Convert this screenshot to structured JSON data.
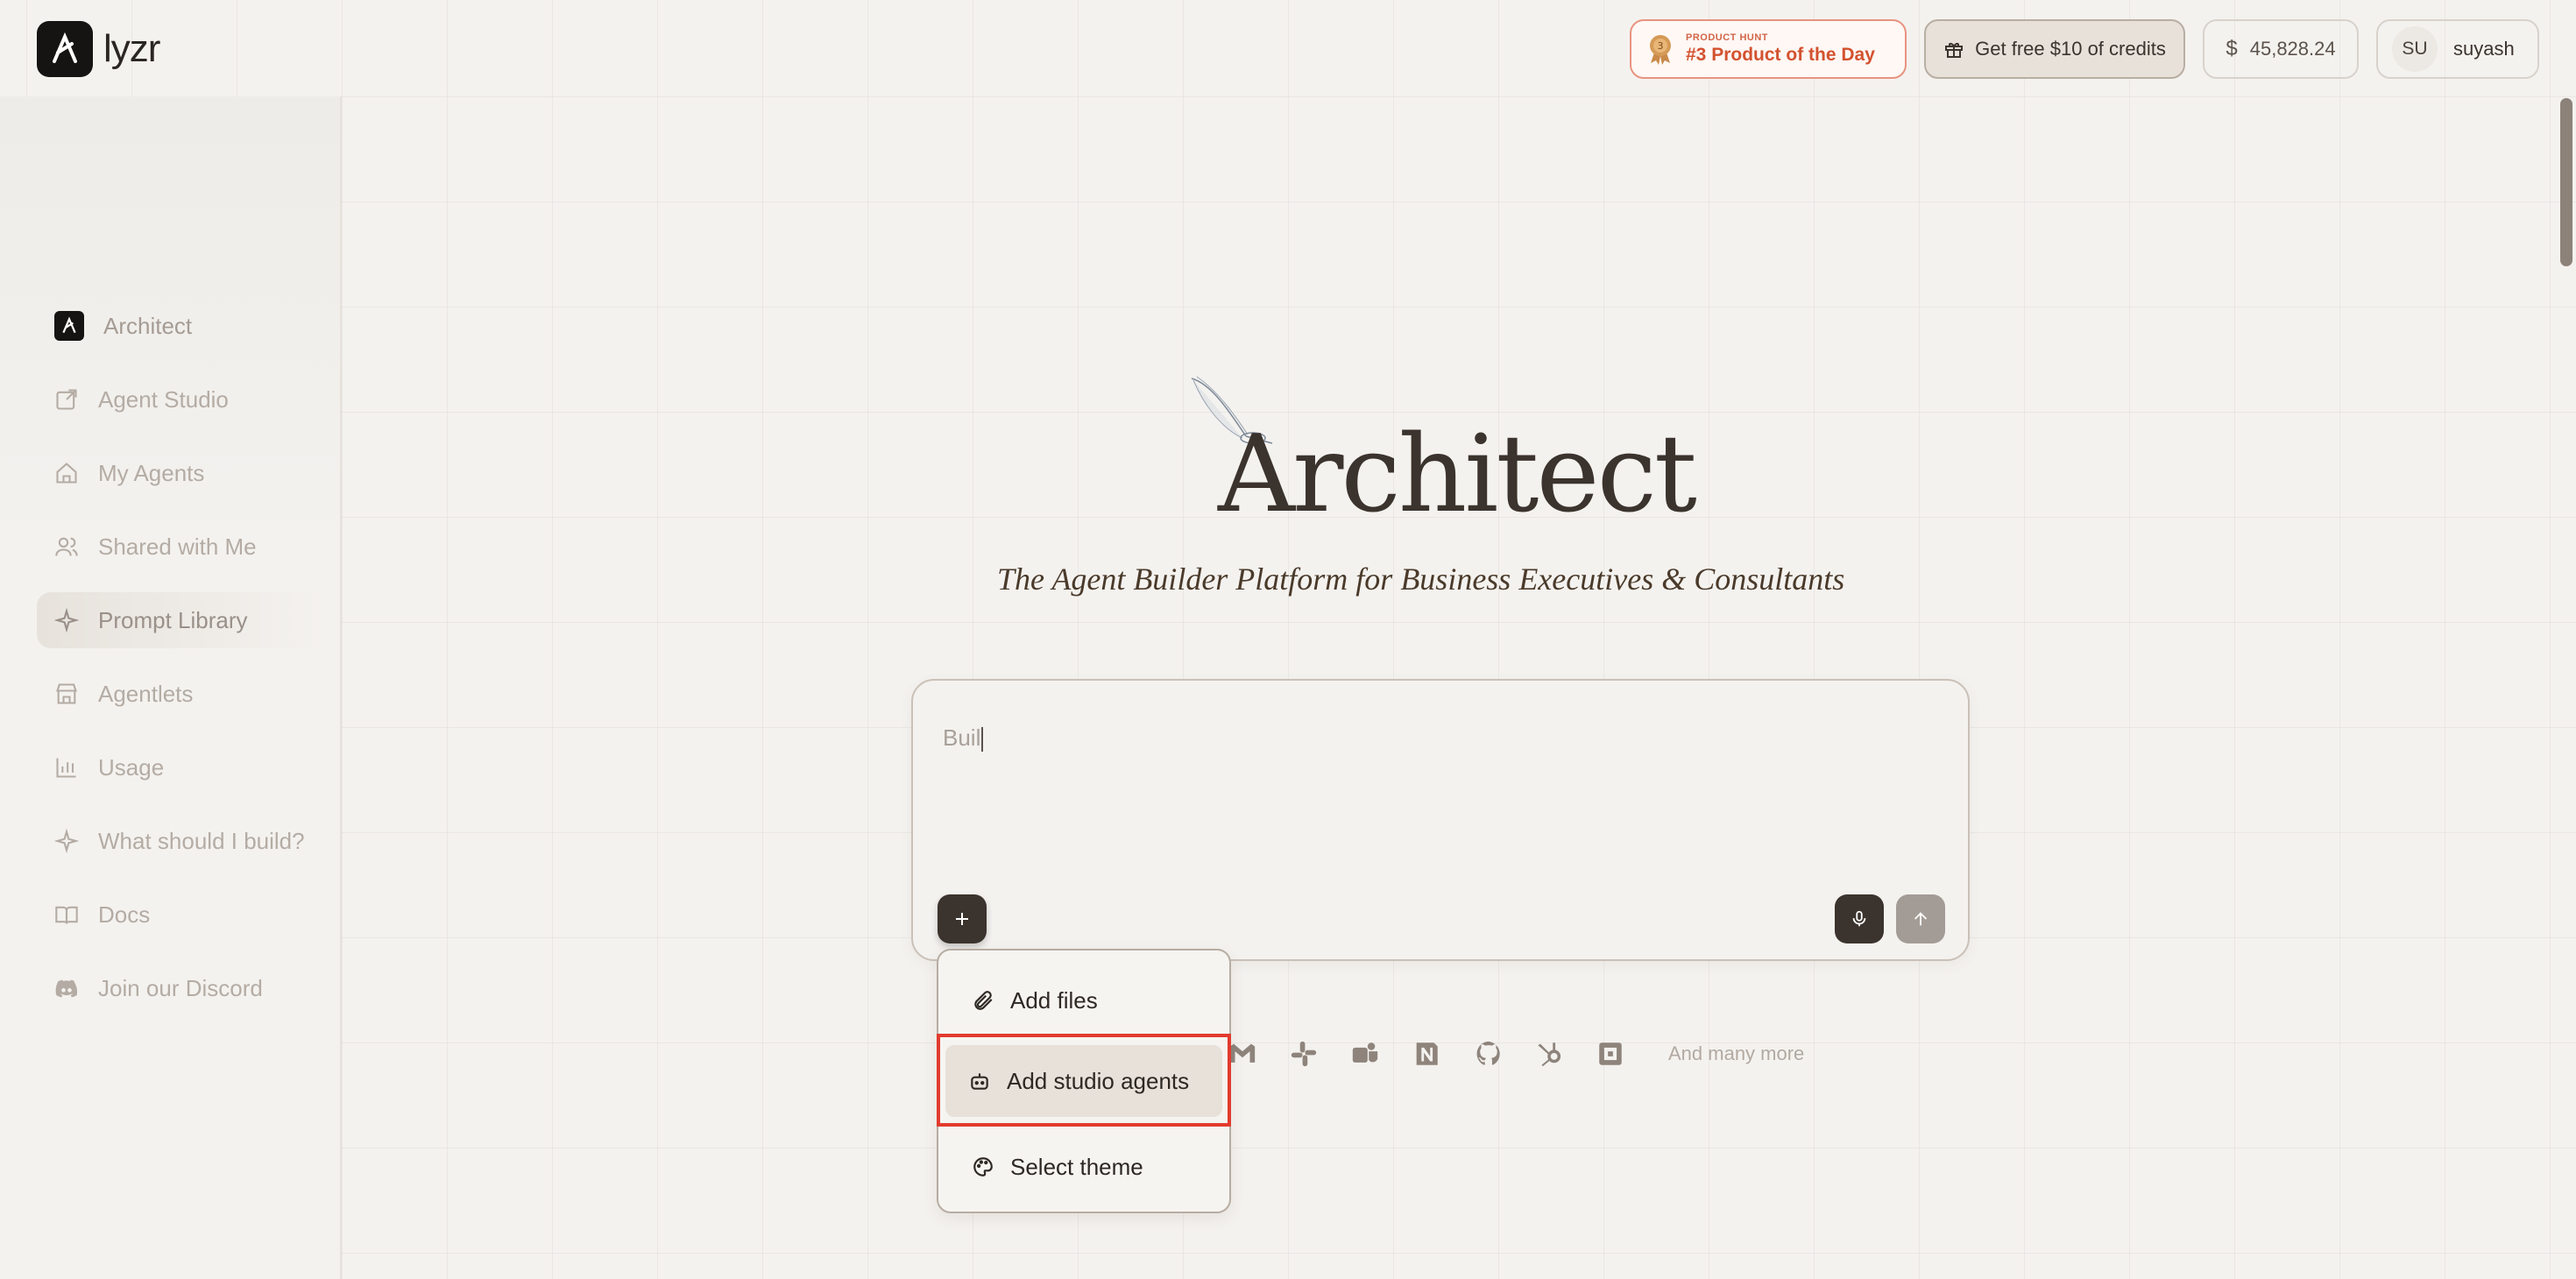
{
  "app": {
    "logo_text": "lyzr"
  },
  "header": {
    "product_hunt": {
      "small": "PRODUCT HUNT",
      "big": "#3 Product of the Day",
      "rank": "3"
    },
    "credits_label": "Get free $10 of credits",
    "balance": "45,828.24",
    "user_initials": "SU",
    "user_name": "suyash"
  },
  "sidebar": {
    "items": [
      {
        "label": "Architect",
        "icon": "architect-logo-icon"
      },
      {
        "label": "Agent Studio",
        "icon": "external-link-icon"
      },
      {
        "label": "My Agents",
        "icon": "home-icon"
      },
      {
        "label": "Shared with Me",
        "icon": "users-icon"
      },
      {
        "label": "Prompt Library",
        "icon": "sparkle-icon"
      },
      {
        "label": "Agentlets",
        "icon": "store-icon"
      },
      {
        "label": "Usage",
        "icon": "bar-chart-icon"
      },
      {
        "label": "What should I build?",
        "icon": "sparkle-icon"
      },
      {
        "label": "Docs",
        "icon": "book-icon"
      },
      {
        "label": "Join our Discord",
        "icon": "discord-icon"
      }
    ],
    "active": "Prompt Library"
  },
  "main": {
    "title": "Architect",
    "subtitle": "The Agent Builder Platform for Business Executives & Consultants",
    "prompt_value": "Buil",
    "more_label": "And many more"
  },
  "attach_menu": {
    "items": [
      {
        "label": "Add files",
        "icon": "paperclip-icon"
      },
      {
        "label": "Add studio agents",
        "icon": "bot-icon"
      },
      {
        "label": "Select theme",
        "icon": "palette-icon"
      }
    ],
    "highlighted": "Add studio agents"
  },
  "integrations": [
    "gmail-icon",
    "slack-icon",
    "teams-icon",
    "notion-icon",
    "github-icon",
    "hubspot-icon",
    "app-icon"
  ],
  "colors": {
    "accent": "#3b332d",
    "highlight": "#e23b2e",
    "product_hunt": "#d3522f"
  }
}
